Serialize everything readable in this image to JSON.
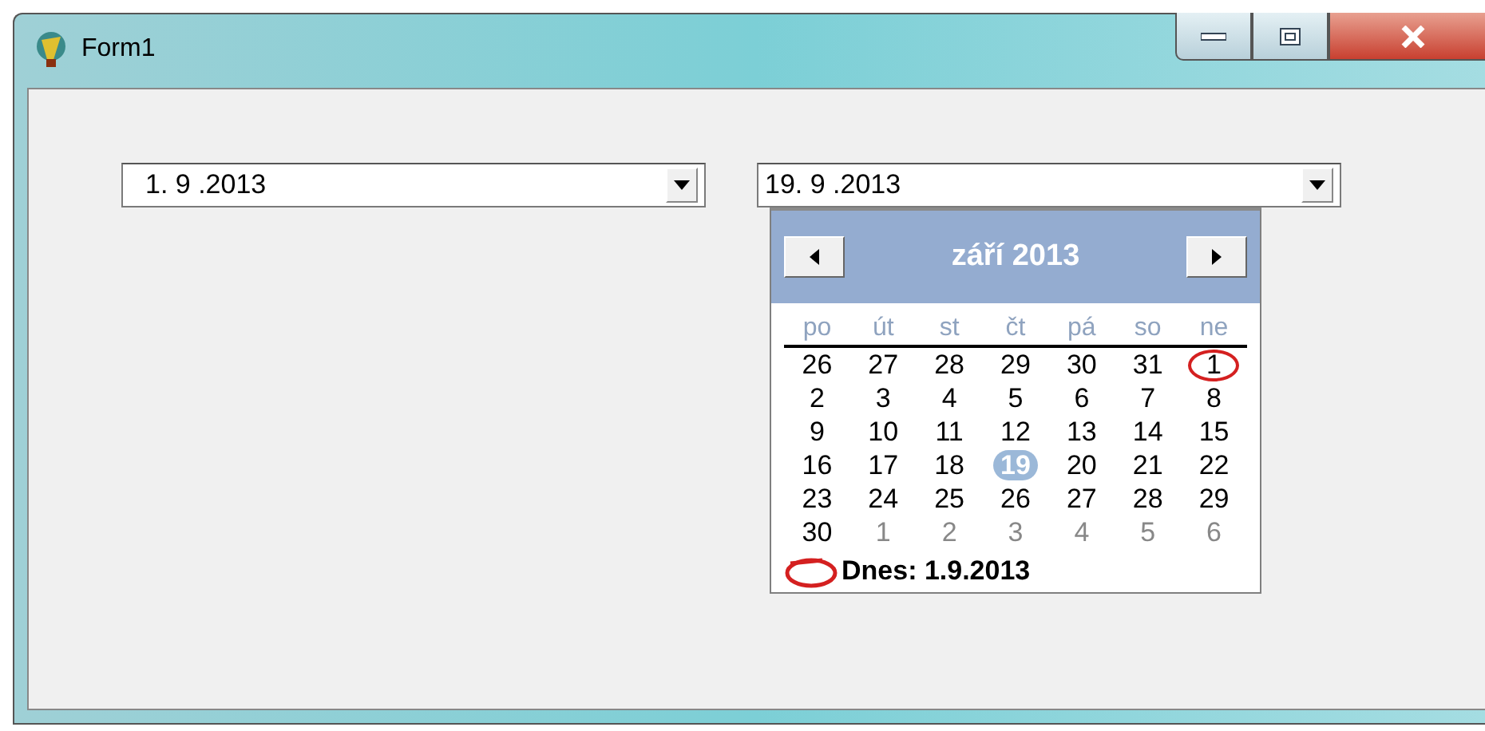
{
  "window": {
    "title": "Form1"
  },
  "combos": [
    {
      "value": "1. 9 .2013",
      "open": false
    },
    {
      "value": "19. 9 .2013",
      "open": true
    }
  ],
  "calendar": {
    "month_title": "září 2013",
    "weekdays": [
      "po",
      "út",
      "st",
      "čt",
      "pá",
      "so",
      "ne"
    ],
    "weeks": [
      [
        {
          "day": "26",
          "other_month": false,
          "selected": false,
          "today": false
        },
        {
          "day": "27",
          "other_month": false,
          "selected": false,
          "today": false
        },
        {
          "day": "28",
          "other_month": false,
          "selected": false,
          "today": false
        },
        {
          "day": "29",
          "other_month": false,
          "selected": false,
          "today": false
        },
        {
          "day": "30",
          "other_month": false,
          "selected": false,
          "today": false
        },
        {
          "day": "31",
          "other_month": false,
          "selected": false,
          "today": false
        },
        {
          "day": "1",
          "other_month": false,
          "selected": false,
          "today": true
        }
      ],
      [
        {
          "day": "2",
          "other_month": false,
          "selected": false,
          "today": false
        },
        {
          "day": "3",
          "other_month": false,
          "selected": false,
          "today": false
        },
        {
          "day": "4",
          "other_month": false,
          "selected": false,
          "today": false
        },
        {
          "day": "5",
          "other_month": false,
          "selected": false,
          "today": false
        },
        {
          "day": "6",
          "other_month": false,
          "selected": false,
          "today": false
        },
        {
          "day": "7",
          "other_month": false,
          "selected": false,
          "today": false
        },
        {
          "day": "8",
          "other_month": false,
          "selected": false,
          "today": false
        }
      ],
      [
        {
          "day": "9",
          "other_month": false,
          "selected": false,
          "today": false
        },
        {
          "day": "10",
          "other_month": false,
          "selected": false,
          "today": false
        },
        {
          "day": "11",
          "other_month": false,
          "selected": false,
          "today": false
        },
        {
          "day": "12",
          "other_month": false,
          "selected": false,
          "today": false
        },
        {
          "day": "13",
          "other_month": false,
          "selected": false,
          "today": false
        },
        {
          "day": "14",
          "other_month": false,
          "selected": false,
          "today": false
        },
        {
          "day": "15",
          "other_month": false,
          "selected": false,
          "today": false
        }
      ],
      [
        {
          "day": "16",
          "other_month": false,
          "selected": false,
          "today": false
        },
        {
          "day": "17",
          "other_month": false,
          "selected": false,
          "today": false
        },
        {
          "day": "18",
          "other_month": false,
          "selected": false,
          "today": false
        },
        {
          "day": "19",
          "other_month": false,
          "selected": true,
          "today": false
        },
        {
          "day": "20",
          "other_month": false,
          "selected": false,
          "today": false
        },
        {
          "day": "21",
          "other_month": false,
          "selected": false,
          "today": false
        },
        {
          "day": "22",
          "other_month": false,
          "selected": false,
          "today": false
        }
      ],
      [
        {
          "day": "23",
          "other_month": false,
          "selected": false,
          "today": false
        },
        {
          "day": "24",
          "other_month": false,
          "selected": false,
          "today": false
        },
        {
          "day": "25",
          "other_month": false,
          "selected": false,
          "today": false
        },
        {
          "day": "26",
          "other_month": false,
          "selected": false,
          "today": false
        },
        {
          "day": "27",
          "other_month": false,
          "selected": false,
          "today": false
        },
        {
          "day": "28",
          "other_month": false,
          "selected": false,
          "today": false
        },
        {
          "day": "29",
          "other_month": false,
          "selected": false,
          "today": false
        }
      ],
      [
        {
          "day": "30",
          "other_month": false,
          "selected": false,
          "today": false
        },
        {
          "day": "1",
          "other_month": true,
          "selected": false,
          "today": false
        },
        {
          "day": "2",
          "other_month": true,
          "selected": false,
          "today": false
        },
        {
          "day": "3",
          "other_month": true,
          "selected": false,
          "today": false
        },
        {
          "day": "4",
          "other_month": true,
          "selected": false,
          "today": false
        },
        {
          "day": "5",
          "other_month": true,
          "selected": false,
          "today": false
        },
        {
          "day": "6",
          "other_month": true,
          "selected": false,
          "today": false
        }
      ]
    ],
    "today_label": "Dnes: 1.9.2013"
  }
}
